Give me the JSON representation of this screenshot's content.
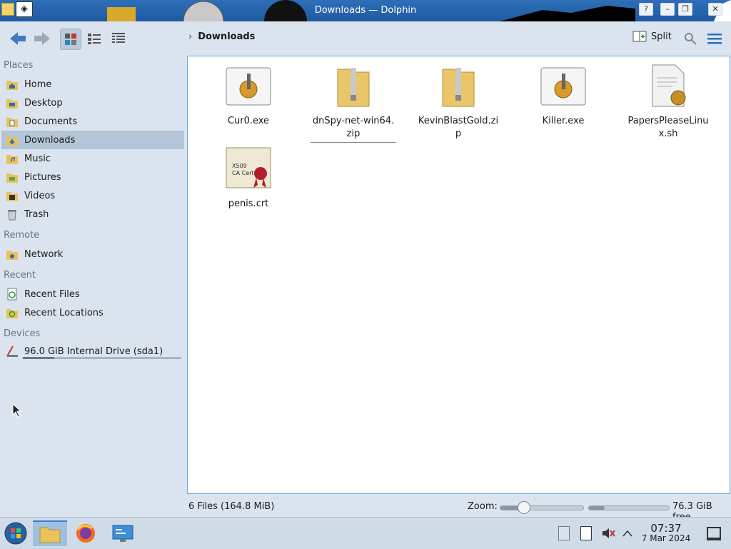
{
  "window": {
    "title": "Downloads — Dolphin"
  },
  "toolbar": {
    "breadcrumb": "Downloads",
    "split_label": "Split",
    "icons": [
      "back-icon",
      "forward-icon",
      "icons-view-icon",
      "compact-view-icon",
      "details-view-icon",
      "split-icon",
      "search-icon",
      "hamburger-menu-icon"
    ]
  },
  "sidebar": {
    "places_header": "Places",
    "places": [
      {
        "label": "Home",
        "icon": "home-folder-icon"
      },
      {
        "label": "Desktop",
        "icon": "desktop-folder-icon"
      },
      {
        "label": "Documents",
        "icon": "documents-folder-icon"
      },
      {
        "label": "Downloads",
        "icon": "downloads-folder-icon",
        "selected": true
      },
      {
        "label": "Music",
        "icon": "music-folder-icon"
      },
      {
        "label": "Pictures",
        "icon": "pictures-folder-icon"
      },
      {
        "label": "Videos",
        "icon": "videos-folder-icon"
      },
      {
        "label": "Trash",
        "icon": "trash-icon"
      }
    ],
    "remote_header": "Remote",
    "remote": [
      {
        "label": "Network",
        "icon": "network-folder-icon"
      }
    ],
    "recent_header": "Recent",
    "recent": [
      {
        "label": "Recent Files",
        "icon": "recent-files-icon"
      },
      {
        "label": "Recent Locations",
        "icon": "recent-locations-icon"
      }
    ],
    "devices_header": "Devices",
    "devices": [
      {
        "label": "96.0 GiB Internal Drive (sda1)",
        "icon": "drive-icon",
        "usage_fraction": 0.2
      }
    ]
  },
  "files": [
    {
      "name": "Cur0.exe",
      "icon": "executable-icon"
    },
    {
      "name": "dnSpy-net-win64.zip",
      "icon": "zip-folder-icon"
    },
    {
      "name": "KevinBlastGold.zip",
      "icon": "zip-folder-icon"
    },
    {
      "name": "Killer.exe",
      "icon": "executable-icon"
    },
    {
      "name": "PapersPleaseLinux.sh",
      "icon": "shell-script-icon"
    },
    {
      "name": "penis.crt",
      "icon": "certificate-icon"
    }
  ],
  "statusbar": {
    "summary": "6 Files (164.8 MiB)",
    "zoom_label": "Zoom:",
    "zoom_fraction": 0.28,
    "space_used_fraction": 0.2,
    "free_space": "76.3 GiB free"
  },
  "taskbar": {
    "time": "07:37",
    "date": "7 Mar 2024",
    "apps": [
      "start-menu-icon",
      "dolphin-icon",
      "firefox-icon",
      "system-settings-icon"
    ],
    "tray": [
      "clipboard-icon",
      "notes-icon",
      "muted-speaker-icon",
      "chevron-up-icon",
      "show-desktop-icon"
    ]
  },
  "colors": {
    "accent": "#3b7fd0",
    "selection": "#b3c6d8",
    "titlebar": "#1f5aa0"
  }
}
